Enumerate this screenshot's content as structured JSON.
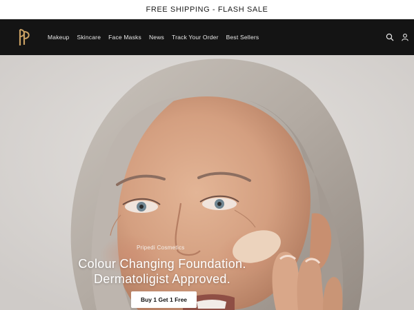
{
  "announcement": {
    "text": "FREE SHIPPING - FLASH SALE"
  },
  "header": {
    "logo_icon": "pp-monogram-logo",
    "nav": [
      {
        "label": "Makeup"
      },
      {
        "label": "Skincare"
      },
      {
        "label": "Face Masks"
      },
      {
        "label": "News"
      },
      {
        "label": "Track Your Order"
      },
      {
        "label": "Best Sellers"
      }
    ],
    "icons": [
      "search-icon",
      "account-icon"
    ]
  },
  "hero": {
    "eyebrow": "Pripedi Cosmetics",
    "heading_line1": "Colour Changing Foundation.",
    "heading_line2": "Dermatoligist Approved.",
    "cta_label": "Buy 1 Get 1 Free"
  },
  "colors": {
    "header_bg": "#141414",
    "logo_gold": "#c9a063",
    "announcement_bg": "#ffffff",
    "cta_bg": "#ffffff"
  }
}
